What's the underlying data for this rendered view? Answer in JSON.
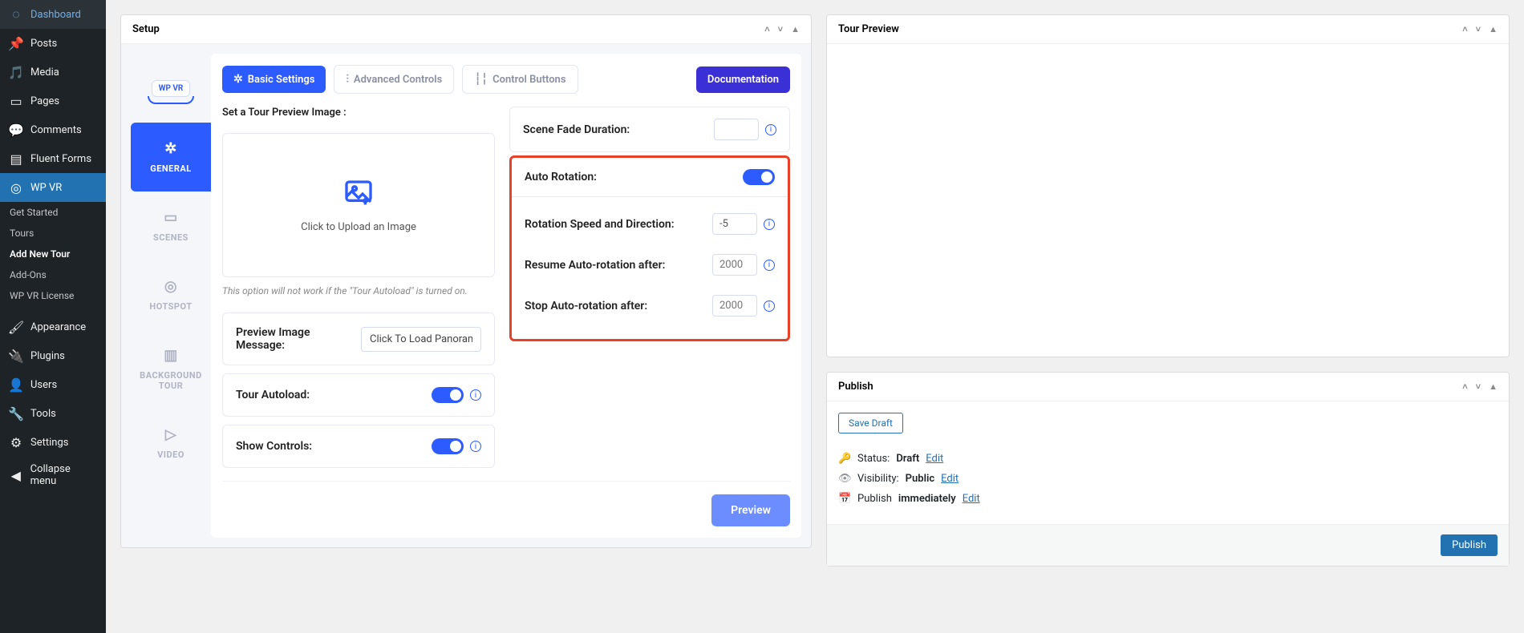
{
  "sidebar": {
    "items": [
      {
        "label": "Dashboard"
      },
      {
        "label": "Posts"
      },
      {
        "label": "Media"
      },
      {
        "label": "Pages"
      },
      {
        "label": "Comments"
      },
      {
        "label": "Fluent Forms"
      },
      {
        "label": "WP VR"
      },
      {
        "label": "Appearance"
      },
      {
        "label": "Plugins"
      },
      {
        "label": "Users"
      },
      {
        "label": "Tools"
      },
      {
        "label": "Settings"
      },
      {
        "label": "Collapse menu"
      }
    ],
    "subitems": [
      {
        "label": "Get Started"
      },
      {
        "label": "Tours"
      },
      {
        "label": "Add New Tour"
      },
      {
        "label": "Add-Ons"
      },
      {
        "label": "WP VR License"
      }
    ]
  },
  "setup": {
    "title": "Setup",
    "logo": "WP VR",
    "vtabs": {
      "general": "GENERAL",
      "scenes": "SCENES",
      "hotspot": "HOTSPOT",
      "background": "BACKGROUND TOUR",
      "video": "VIDEO"
    },
    "tabs": {
      "basic": "Basic Settings",
      "advanced": "Advanced Controls",
      "control": "Control Buttons",
      "doc": "Documentation"
    },
    "preview_label": "Set a Tour Preview Image :",
    "upload_text": "Click to Upload an Image",
    "hint": "This option will not work if the \"Tour Autoload\" is turned on.",
    "preview_msg": {
      "label": "Preview Image Message:",
      "value": "Click To Load Panoram"
    },
    "autoload": "Tour Autoload:",
    "show_controls": "Show Controls:",
    "fade": {
      "label": "Scene Fade Duration:",
      "value": ""
    },
    "rotation": {
      "label": "Auto Rotation:",
      "speed": {
        "label": "Rotation Speed and Direction:",
        "value": "-5"
      },
      "resume": {
        "label": "Resume Auto-rotation after:",
        "placeholder": "2000"
      },
      "stop": {
        "label": "Stop Auto-rotation after:",
        "placeholder": "2000"
      }
    },
    "preview_btn": "Preview"
  },
  "tourpreview": {
    "title": "Tour Preview"
  },
  "publish": {
    "title": "Publish",
    "save": "Save Draft",
    "status_label": "Status:",
    "status_value": "Draft",
    "visibility_label": "Visibility:",
    "visibility_value": "Public",
    "schedule_prefix": "Publish",
    "schedule_value": "immediately",
    "edit": "Edit",
    "publish_btn": "Publish"
  }
}
